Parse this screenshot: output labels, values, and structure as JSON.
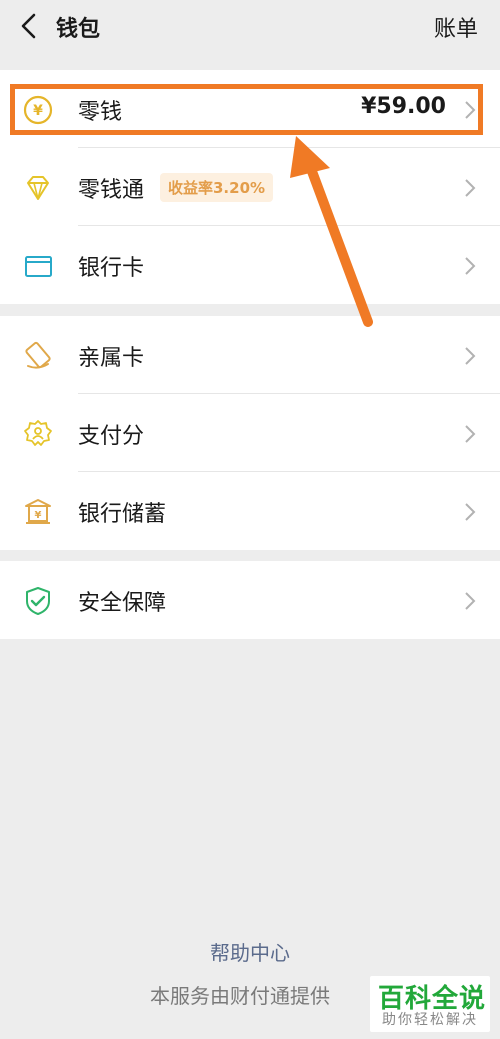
{
  "header": {
    "title": "钱包",
    "bill_label": "账单"
  },
  "group1": {
    "change": {
      "label": "零钱",
      "amount": "¥59.00"
    },
    "licaitong": {
      "label": "零钱通",
      "badge": "收益率3.20%"
    },
    "bank_card": {
      "label": "银行卡"
    }
  },
  "group2": {
    "family_card": {
      "label": "亲属卡"
    },
    "pay_score": {
      "label": "支付分"
    },
    "bank_savings": {
      "label": "银行储蓄"
    }
  },
  "group3": {
    "security": {
      "label": "安全保障"
    }
  },
  "footer": {
    "help": "帮助中心",
    "provider": "本服务由财付通提供"
  },
  "watermark": {
    "main": "百科全说",
    "sub": "助你轻松解决"
  },
  "colors": {
    "accent_orange": "#f07a25",
    "icon_gold": "#e5b52a",
    "icon_teal": "#27a9c9",
    "icon_green": "#2fb46a",
    "watermark_green": "#22a83a"
  }
}
